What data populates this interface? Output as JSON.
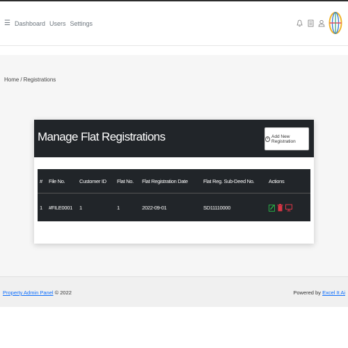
{
  "nav": {
    "links": [
      "Dashboard",
      "Users",
      "Settings"
    ]
  },
  "breadcrumb": {
    "home": "Home",
    "sep": "/",
    "current": "Registrations"
  },
  "card": {
    "title": "Manage Flat Registrations",
    "add_button": "Add New Registration"
  },
  "table": {
    "headers": [
      "#",
      "File No.",
      "Customer ID",
      "Flat No.",
      "Flat Registration Date",
      "Flat Reg. Sub-Deed No.",
      "Actions"
    ],
    "rows": [
      {
        "num": "1",
        "file_no": "#FILE0001",
        "customer_id": "1",
        "flat_no": "1",
        "date": "2022-09-01",
        "sub_deed": "SD11110000"
      }
    ]
  },
  "footer": {
    "brand": "Property Admin Panel",
    "copy": "© 2022",
    "powered": "Powered by",
    "company": "Excel It Ai"
  },
  "colors": {
    "edit": "#28a745",
    "delete": "#dc3545",
    "view": "#dc3545",
    "header_bg": "#212529"
  }
}
